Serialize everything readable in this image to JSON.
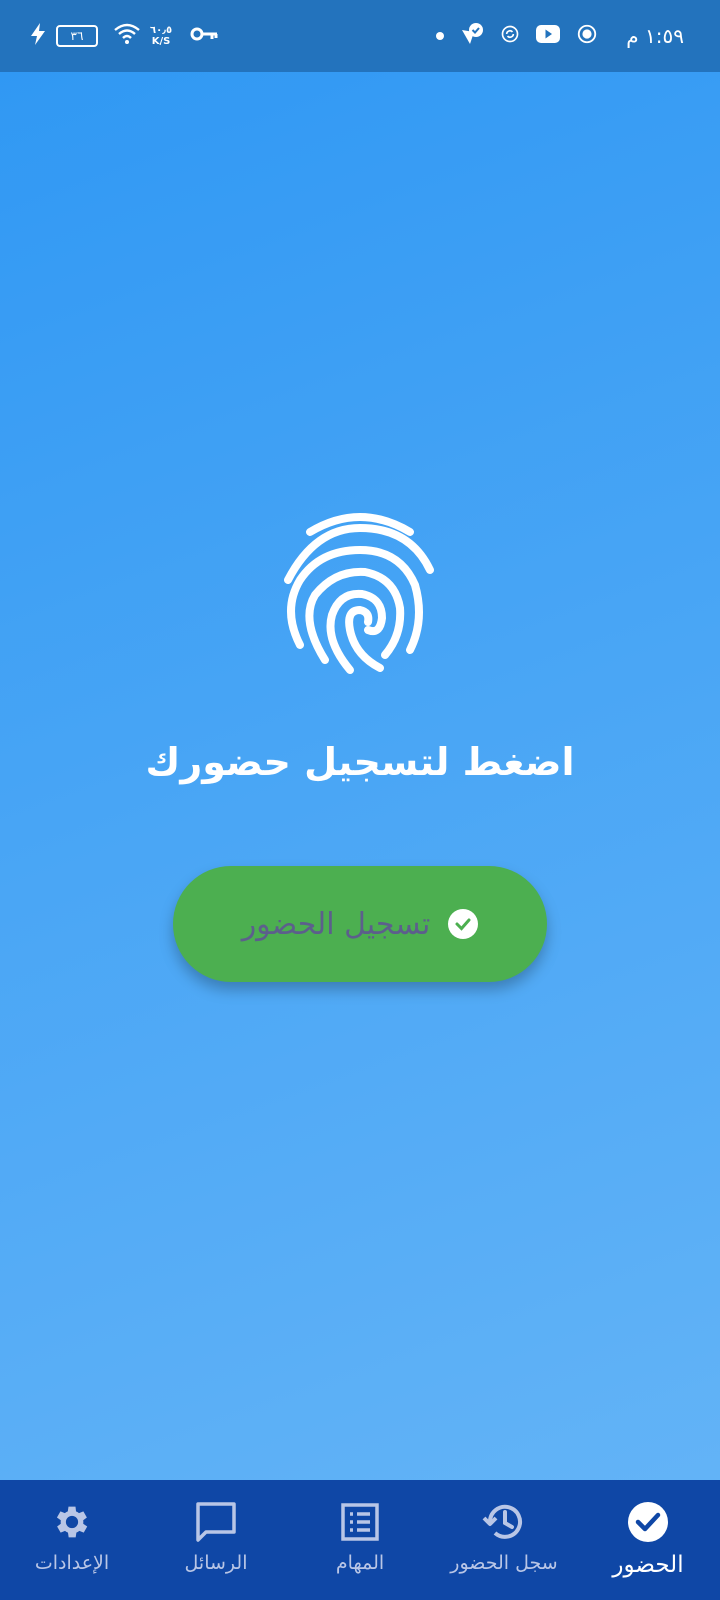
{
  "status_bar": {
    "time": "١:٥٩ م",
    "battery_level": "٣٦",
    "net_speed_value": "٦٠٫٥",
    "net_speed_unit": "K/S",
    "icons_right": [
      "dot-icon",
      "notification-check-icon",
      "sync-icon",
      "youtube-icon",
      "vpn-status-icon"
    ],
    "icons_left": [
      "charging-bolt-icon",
      "battery-icon",
      "wifi-icon",
      "vpn-key-icon"
    ]
  },
  "main": {
    "icon": "fingerprint-icon",
    "prompt": "اضغط لتسجيل حضورك",
    "checkin_button_label": "تسجيل الحضور",
    "checkin_button_icon": "check-circle-icon",
    "button_color": "#4caf50"
  },
  "bottom_nav": {
    "items": [
      {
        "label": "الحضور",
        "icon": "check-circle-icon",
        "active": true
      },
      {
        "label": "سجل الحضور",
        "icon": "history-icon",
        "active": false
      },
      {
        "label": "المهام",
        "icon": "tasks-list-icon",
        "active": false
      },
      {
        "label": "الرسائل",
        "icon": "message-icon",
        "active": false
      },
      {
        "label": "الإعدادات",
        "icon": "gear-icon",
        "active": false
      }
    ],
    "background": "#0f47a6"
  }
}
